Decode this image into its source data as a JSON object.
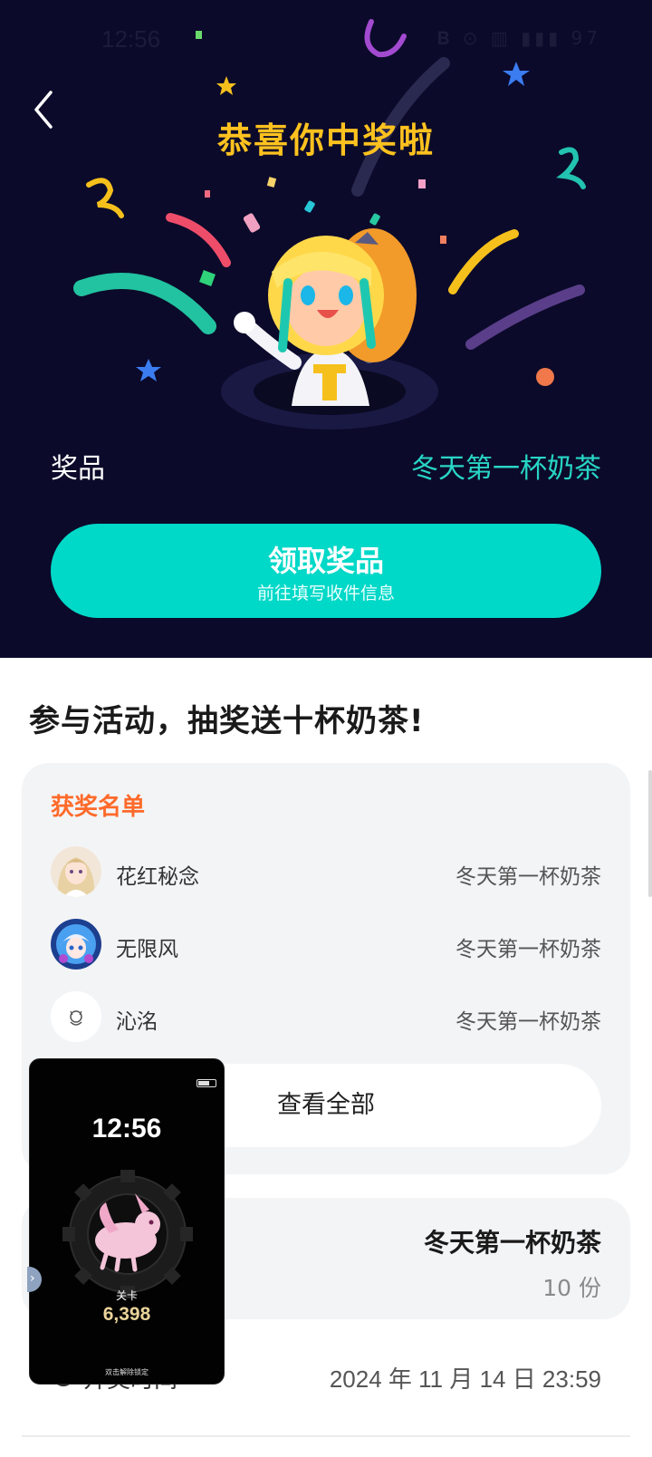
{
  "status_bar": {
    "time": "12:56",
    "icons": "𝐁 ⊙ ▥ ▮▮▮ 97"
  },
  "hero": {
    "title": "恭喜你中奖啦",
    "prize_label": "奖品",
    "prize_value": "冬天第一杯奶茶",
    "claim_button": {
      "label": "领取奖品",
      "sublabel": "前往填写收件信息"
    }
  },
  "activity": {
    "title": "参与活动，抽奖送十杯奶茶!"
  },
  "winners": {
    "heading": "获奖名单",
    "items": [
      {
        "name": "花红秘念",
        "prize": "冬天第一杯奶茶"
      },
      {
        "name": "无限风",
        "prize": "冬天第一杯奶茶"
      },
      {
        "name": "沁洺",
        "prize": "冬天第一杯奶茶"
      }
    ],
    "view_all": "查看全部"
  },
  "prize_info": {
    "name": "冬天第一杯奶茶",
    "quantity": "10 份"
  },
  "draw_time": {
    "label": "开奖时间",
    "value": "2024 年 11 月 14 日 23:59"
  },
  "floating_window": {
    "time": "12:56",
    "level_label": "关卡",
    "level_value": "6,398",
    "unlock_hint": "双击解除锁定"
  },
  "colors": {
    "hero_bg": "#0b0a2a",
    "title_gold": "#ffc21f",
    "accent_teal": "#00d8c8",
    "winners_heading": "#ff6a2a"
  },
  "icons": [
    "back-arrow-icon",
    "clock-icon",
    "chevron-right-icon"
  ]
}
